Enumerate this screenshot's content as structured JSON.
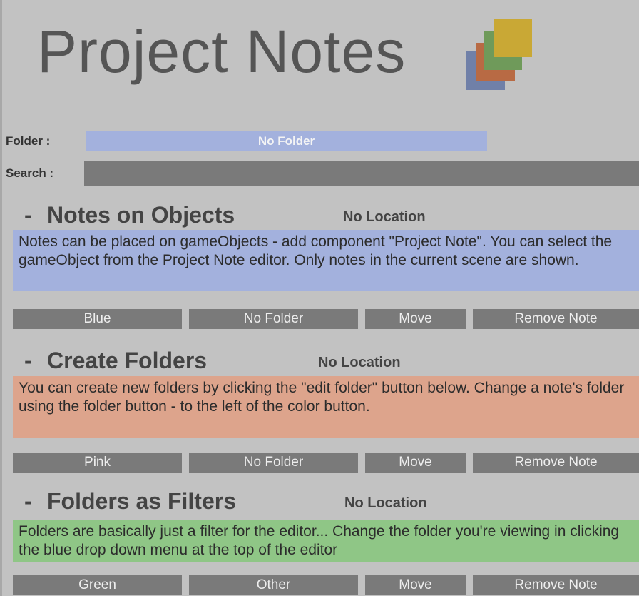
{
  "header": {
    "title": "Project Notes",
    "logo_icon": "stacked-notes-icon",
    "logo_colors": [
      "#7080a8",
      "#b86a44",
      "#6f9a5a",
      "#c9a835"
    ]
  },
  "folder": {
    "label": "Folder :",
    "value": "No Folder"
  },
  "search": {
    "label": "Search :",
    "value": ""
  },
  "notes": [
    {
      "collapse": "-",
      "title": "Notes on Objects",
      "location": "No Location",
      "body": "Notes can be placed on gameObjects - add component \"Project Note\". You can select the gameObject from the Project Note editor. Only notes in the current scene are shown.",
      "color": "#a3b1dd",
      "buttons": {
        "color": "Blue",
        "folder": "No Folder",
        "move": "Move",
        "remove": "Remove Note"
      }
    },
    {
      "collapse": "-",
      "title": "Create Folders",
      "location": "No Location",
      "body": "You can create new folders by clicking the \"edit folder\" button below. Change a note's folder using the folder button - to the left of the color button.",
      "color": "#dda48c",
      "buttons": {
        "color": "Pink",
        "folder": "No Folder",
        "move": "Move",
        "remove": "Remove Note"
      }
    },
    {
      "collapse": "-",
      "title": "Folders as Filters",
      "location": "No Location",
      "body": "Folders are basically just a filter for the editor... Change the folder you're viewing in clicking the blue drop down menu at the top of the editor",
      "color": "#8fc686",
      "buttons": {
        "color": "Green",
        "folder": "Other",
        "move": "Move",
        "remove": "Remove Note"
      }
    }
  ]
}
